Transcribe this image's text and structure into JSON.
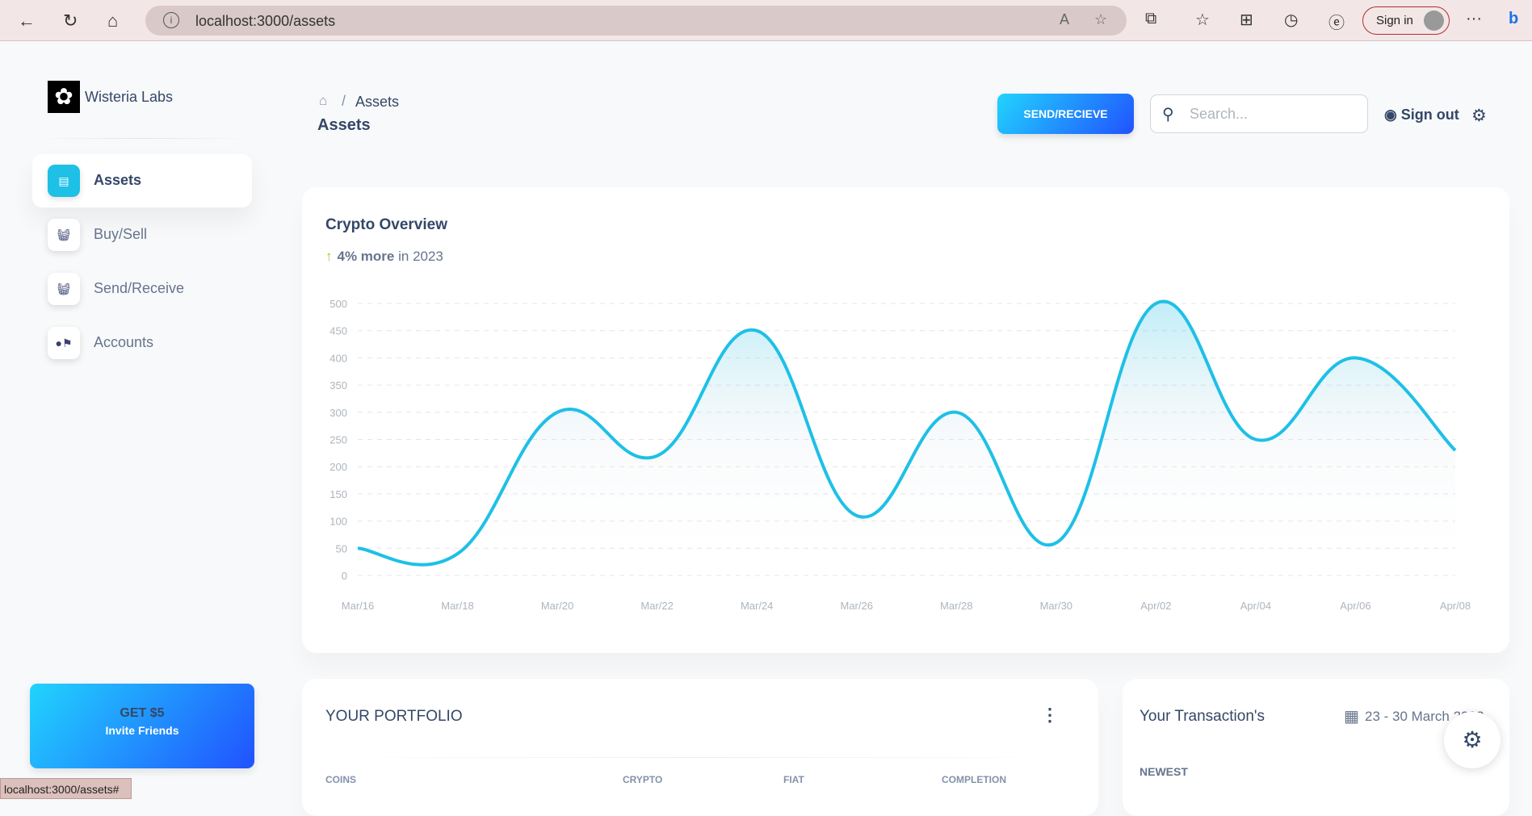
{
  "browser": {
    "url": "localhost:3000/assets",
    "sign_in": "Sign in",
    "status_url": "localhost:3000/assets#"
  },
  "sidebar": {
    "brand": "Wisteria Labs",
    "items": [
      {
        "label": "Assets",
        "icon": "shop-icon",
        "active": true
      },
      {
        "label": "Buy/Sell",
        "icon": "basket-icon"
      },
      {
        "label": "Send/Receive",
        "icon": "basket-icon"
      },
      {
        "label": "Accounts",
        "icon": "user-flag-icon"
      }
    ],
    "invite": {
      "title": "GET $5",
      "subtitle": "Invite Friends"
    }
  },
  "header": {
    "breadcrumb_current": "Assets",
    "breadcrumb_sep": "/",
    "title": "Assets",
    "send_button": "SEND/RECIEVE",
    "search_placeholder": "Search...",
    "sign_out": "Sign out"
  },
  "overview": {
    "title": "Crypto Overview",
    "change": "4% more",
    "period": "in 2023"
  },
  "chart_data": {
    "type": "area",
    "categories": [
      "Mar/16",
      "Mar/18",
      "Mar/20",
      "Mar/22",
      "Mar/24",
      "Mar/26",
      "Mar/28",
      "Mar/30",
      "Apr/02",
      "Apr/04",
      "Apr/06",
      "Apr/08"
    ],
    "values": [
      50,
      40,
      300,
      220,
      450,
      110,
      300,
      60,
      500,
      250,
      400,
      230
    ],
    "y_ticks": [
      "500",
      "450",
      "400",
      "350",
      "300",
      "250",
      "200",
      "150",
      "100",
      "50",
      "0"
    ],
    "ylim": [
      0,
      500
    ],
    "grid": true,
    "color": "#1ec0e6"
  },
  "portfolio": {
    "title": "YOUR PORTFOLIO",
    "columns": [
      "COINS",
      "CRYPTO",
      "FIAT",
      "COMPLETION"
    ]
  },
  "transactions": {
    "title": "Your Transaction's",
    "date_range": "23 - 30 March 2023",
    "section": "NEWEST"
  },
  "colors": {
    "accent": "#1ec0e6",
    "gradient_start": "#21d4fd",
    "gradient_end": "#2152ff",
    "text": "#344767"
  }
}
